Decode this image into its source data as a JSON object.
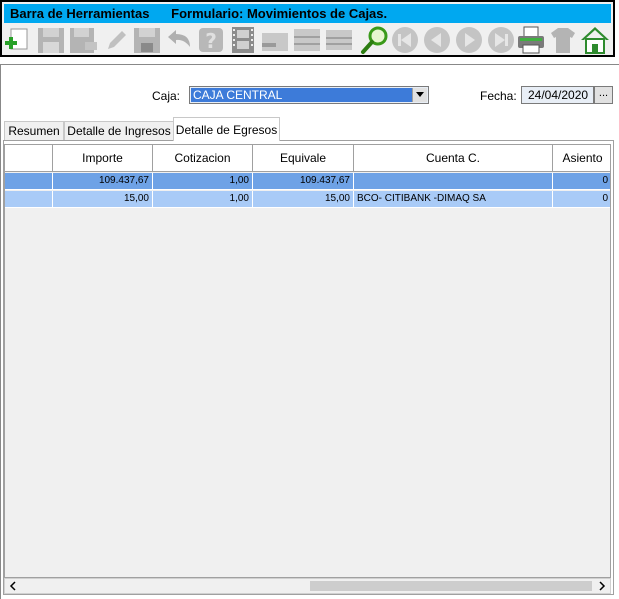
{
  "toolbar": {
    "title_left": "Barra de Herramientas",
    "title_right": "Formulario: Movimientos de Cajas.",
    "buttons": [
      {
        "icon": "add-icon",
        "enabled": true
      },
      {
        "icon": "save-icon",
        "enabled": false
      },
      {
        "icon": "save-as-icon",
        "enabled": false
      },
      {
        "icon": "edit-icon",
        "enabled": false
      },
      {
        "icon": "save-disk-icon",
        "enabled": false
      },
      {
        "icon": "undo-icon",
        "enabled": false
      },
      {
        "icon": "help-icon",
        "enabled": false
      },
      {
        "icon": "film-icon",
        "enabled": false
      },
      {
        "icon": "minus-icon",
        "enabled": false
      },
      {
        "icon": "list-icon",
        "enabled": false
      },
      {
        "icon": "lines-icon",
        "enabled": false
      },
      {
        "icon": "search-icon",
        "enabled": true
      },
      {
        "icon": "first-icon",
        "enabled": false
      },
      {
        "icon": "prev-icon",
        "enabled": false
      },
      {
        "icon": "next-icon",
        "enabled": false
      },
      {
        "icon": "last-icon",
        "enabled": false
      },
      {
        "icon": "print-icon",
        "enabled": true
      },
      {
        "icon": "shirt-icon",
        "enabled": false
      },
      {
        "icon": "home-icon",
        "enabled": true
      }
    ]
  },
  "form": {
    "caja_label": "Caja:",
    "caja_value": "CAJA CENTRAL",
    "fecha_label": "Fecha:",
    "fecha_value": "24/04/2020",
    "fecha_button": "..."
  },
  "tabs": [
    {
      "label": "Resumen",
      "selected": false
    },
    {
      "label": "Detalle de Ingresos",
      "selected": false
    },
    {
      "label": "Detalle de Egresos",
      "selected": true
    }
  ],
  "grid": {
    "columns": [
      "",
      "Importe",
      "Cotizacion",
      "Equivale",
      "Cuenta C.",
      "Asiento"
    ],
    "rows": [
      [
        "",
        "109.437,67",
        "1,00",
        "109.437,67",
        "",
        "0"
      ],
      [
        "",
        "15,00",
        "1,00",
        "15,00",
        "BCO- CITIBANK -DIMAQ SA",
        "0"
      ]
    ]
  },
  "colors": {
    "title_bar": "#00a8f0",
    "row_selected": "#6ea2e6",
    "row_normal": "#a9cbf7",
    "combo_highlight": "#3d7bd9"
  }
}
